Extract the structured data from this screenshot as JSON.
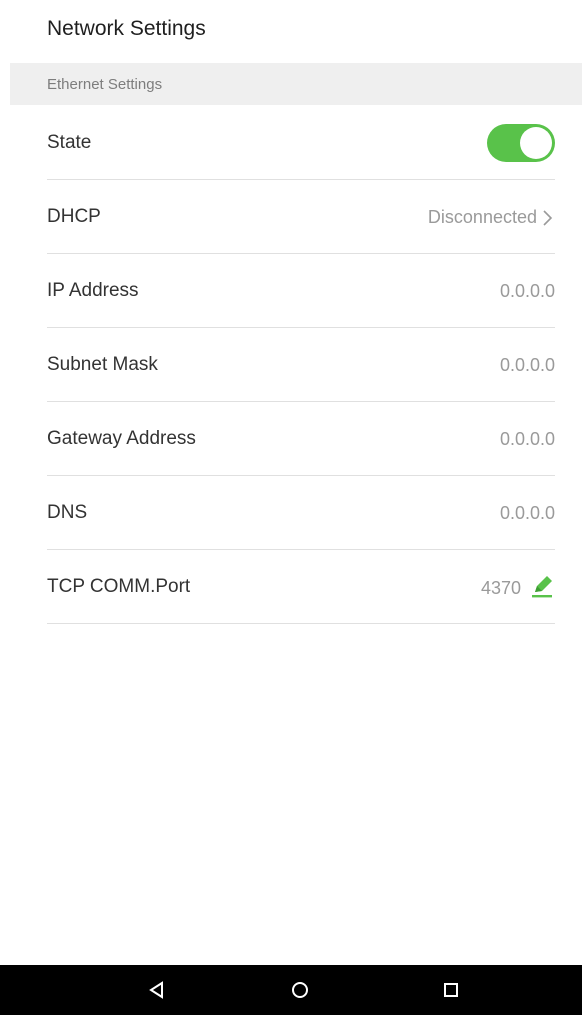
{
  "header": {
    "title": "Network Settings"
  },
  "section": {
    "title": "Ethernet Settings"
  },
  "rows": [
    {
      "label": "State",
      "type": "toggle",
      "checked": true
    },
    {
      "label": "DHCP",
      "value": "Disconnected",
      "type": "link"
    },
    {
      "label": "IP Address",
      "value": "0.0.0.0",
      "type": "value"
    },
    {
      "label": "Subnet Mask",
      "value": "0.0.0.0",
      "type": "value"
    },
    {
      "label": "Gateway Address",
      "value": "0.0.0.0",
      "type": "value"
    },
    {
      "label": "DNS",
      "value": "0.0.0.0",
      "type": "value"
    },
    {
      "label": "TCP COMM.Port",
      "value": "4370",
      "type": "edit"
    }
  ],
  "colors": {
    "accent": "#59c24a",
    "section_bg": "#efefef",
    "nav_bg": "#000000"
  },
  "icons": {
    "dhcp": "chevron-right-icon",
    "port": "edit-pencil-icon",
    "nav": [
      "back-triangle-icon",
      "home-circle-icon",
      "recent-square-icon"
    ]
  }
}
